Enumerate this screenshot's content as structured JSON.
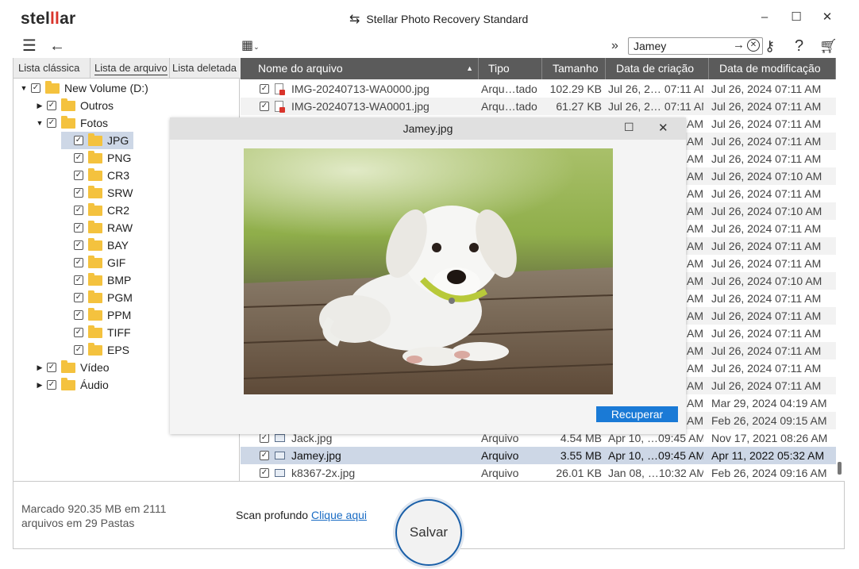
{
  "app": {
    "logo_text_a": "stel",
    "logo_text_b": "ll",
    "logo_text_c": "ar",
    "title": "Stellar Photo Recovery Standard"
  },
  "search": {
    "value": "Jamey"
  },
  "tabs": [
    "Lista clássica",
    "Lista de arquivo",
    "Lista deletada"
  ],
  "tree": [
    {
      "label": "New Volume (D:)",
      "level": 0,
      "caret": "down"
    },
    {
      "label": "Outros",
      "level": 1,
      "caret": "right"
    },
    {
      "label": "Fotos",
      "level": 1,
      "caret": "down"
    },
    {
      "label": "JPG",
      "level": 2,
      "selected": true
    },
    {
      "label": "PNG",
      "level": 2
    },
    {
      "label": "CR3",
      "level": 2
    },
    {
      "label": "SRW",
      "level": 2
    },
    {
      "label": "CR2",
      "level": 2
    },
    {
      "label": "RAW",
      "level": 2
    },
    {
      "label": "BAY",
      "level": 2
    },
    {
      "label": "GIF",
      "level": 2
    },
    {
      "label": "BMP",
      "level": 2
    },
    {
      "label": "PGM",
      "level": 2
    },
    {
      "label": "PPM",
      "level": 2
    },
    {
      "label": "TIFF",
      "level": 2
    },
    {
      "label": "EPS",
      "level": 2
    },
    {
      "label": "Vídeo",
      "level": 1,
      "caret": "right"
    },
    {
      "label": "Áudio",
      "level": 1,
      "caret": "right"
    }
  ],
  "columns": [
    "Nome do arquivo",
    "Tipo",
    "Tamanho",
    "Data de criação",
    "Data de modificação"
  ],
  "rows": [
    {
      "name": "IMG-20240713-WA0000.jpg",
      "type": "Arqu…tado",
      "size": "102.29 KB",
      "created": "Jul 26, 2… 07:11 AM",
      "modified": "Jul 26, 2024 07:11 AM",
      "icon": "red"
    },
    {
      "name": "IMG-20240713-WA0001.jpg",
      "type": "Arqu…tado",
      "size": "61.27 KB",
      "created": "Jul 26, 2… 07:11 AM",
      "modified": "Jul 26, 2024 07:11 AM",
      "icon": "red"
    },
    {
      "name": "",
      "type": "",
      "size": "",
      "created": "AM",
      "modified": "Jul 26, 2024 07:11 AM"
    },
    {
      "name": "",
      "type": "",
      "size": "",
      "created": "AM",
      "modified": "Jul 26, 2024 07:11 AM"
    },
    {
      "name": "",
      "type": "",
      "size": "",
      "created": "AM",
      "modified": "Jul 26, 2024 07:11 AM"
    },
    {
      "name": "",
      "type": "",
      "size": "",
      "created": "AM",
      "modified": "Jul 26, 2024 07:10 AM"
    },
    {
      "name": "",
      "type": "",
      "size": "",
      "created": "AM",
      "modified": "Jul 26, 2024 07:11 AM"
    },
    {
      "name": "",
      "type": "",
      "size": "",
      "created": "AM",
      "modified": "Jul 26, 2024 07:10 AM"
    },
    {
      "name": "",
      "type": "",
      "size": "",
      "created": "AM",
      "modified": "Jul 26, 2024 07:11 AM"
    },
    {
      "name": "",
      "type": "",
      "size": "",
      "created": "AM",
      "modified": "Jul 26, 2024 07:11 AM"
    },
    {
      "name": "",
      "type": "",
      "size": "",
      "created": "AM",
      "modified": "Jul 26, 2024 07:11 AM"
    },
    {
      "name": "",
      "type": "",
      "size": "",
      "created": "AM",
      "modified": "Jul 26, 2024 07:10 AM"
    },
    {
      "name": "",
      "type": "",
      "size": "",
      "created": "AM",
      "modified": "Jul 26, 2024 07:11 AM"
    },
    {
      "name": "",
      "type": "",
      "size": "",
      "created": "AM",
      "modified": "Jul 26, 2024 07:11 AM"
    },
    {
      "name": "",
      "type": "",
      "size": "",
      "created": "AM",
      "modified": "Jul 26, 2024 07:11 AM"
    },
    {
      "name": "",
      "type": "",
      "size": "",
      "created": "AM",
      "modified": "Jul 26, 2024 07:11 AM"
    },
    {
      "name": "",
      "type": "",
      "size": "",
      "created": "AM",
      "modified": "Jul 26, 2024 07:11 AM"
    },
    {
      "name": "",
      "type": "",
      "size": "",
      "created": "AM",
      "modified": "Jul 26, 2024 07:11 AM"
    },
    {
      "name": "",
      "type": "",
      "size": "",
      "created": "AM",
      "modified": "Mar 29, 2024 04:19 AM"
    },
    {
      "name": "",
      "type": "",
      "size": "",
      "created": "AM",
      "modified": "Feb 26, 2024 09:15 AM"
    },
    {
      "name": "Jack.jpg",
      "type": "Arquivo",
      "size": "4.54 MB",
      "created": "Apr 10, …09:45 AM",
      "modified": "Nov 17, 2021 08:26 AM",
      "icon": "img"
    },
    {
      "name": "Jamey.jpg",
      "type": "Arquivo",
      "size": "3.55 MB",
      "created": "Apr 10, …09:45 AM",
      "modified": "Apr 11, 2022 05:32 AM",
      "icon": "img",
      "selected": true
    },
    {
      "name": "k8367-2x.jpg",
      "type": "Arquivo",
      "size": "26.01 KB",
      "created": "Jan 08, …10:32 AM",
      "modified": "Feb 26, 2024 09:16 AM",
      "icon": "img"
    }
  ],
  "preview": {
    "title": "Jamey.jpg",
    "recover_label": "Recuperar"
  },
  "footer": {
    "status_line1": "Marcado 920.35 MB em 2111",
    "status_line2": "arquivos em 29 Pastas",
    "scan_label": "Scan profundo",
    "scan_link": "Clique aqui",
    "save_label": "Salvar"
  },
  "colors": {
    "accent": "#1a7ad6",
    "logo_red": "#d9342b",
    "header_bg": "#5b5b5b",
    "selection": "#cdd7e6"
  }
}
